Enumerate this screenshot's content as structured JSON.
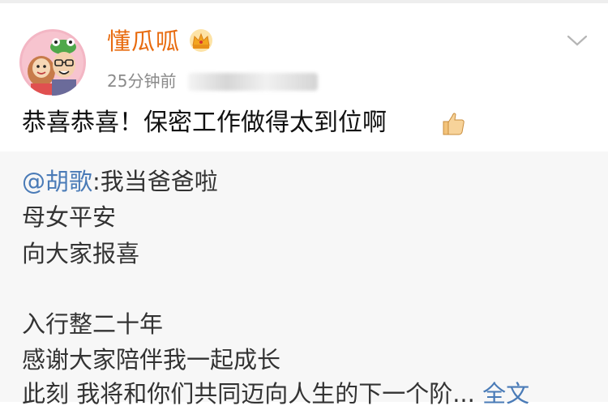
{
  "post": {
    "username": "懂瓜呱",
    "time": "25分钟前",
    "text": "恭喜恭喜！保密工作做得太到位啊"
  },
  "retweet": {
    "mention": "@胡歌",
    "line1_rest": ":我当爸爸啦",
    "line2": "母女平安",
    "line3": "向大家报喜",
    "line4": "入行整二十年",
    "line5": "感谢大家陪伴我一起成长",
    "line6": "此刻 我将和你们共同迈向人生的下一个阶...",
    "full_text_link": "全文"
  },
  "colors": {
    "username": "#e86b0f",
    "link": "#4a7bb7",
    "retweet_bg": "#f7f7f7"
  },
  "icons": [
    "crown-icon",
    "chevron-down-icon",
    "thumbs-up-icon"
  ]
}
